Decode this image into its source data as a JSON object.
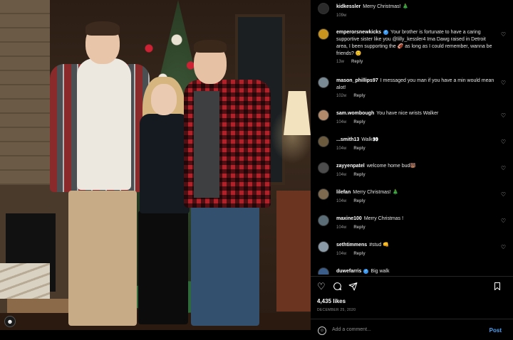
{
  "post": {
    "author": "kidkessler",
    "caption": "Merry Christmas! 🎄",
    "caption_time": "109w",
    "likes": "4,435 likes",
    "date": "DECEMBER 25, 2020",
    "add_comment_placeholder": "Add a comment...",
    "post_label": "Post"
  },
  "comments": [
    {
      "user": "emperorsnewkicks",
      "verified": true,
      "text": "Your brother is fortunate to have a caring supportive sister like you @lilly_kessler4 Ima Dawg raised in Detroit area, I been supporting the 🏈 as long as I could remember, wanna be friends? 😊",
      "time": "13w",
      "reply": "Reply"
    },
    {
      "user": "mason_phillips97",
      "verified": false,
      "text": "I messaged you man if you have a min would mean alot!",
      "time": "102w",
      "reply": "Reply"
    },
    {
      "user": "sam.wombough",
      "verified": false,
      "text": "You have nice wrists Walker",
      "time": "104w",
      "reply": "Reply"
    },
    {
      "user": "...smith13",
      "verified": false,
      "text": "Walk👀",
      "time": "104w",
      "reply": "Reply"
    },
    {
      "user": "zayyenpatel",
      "verified": false,
      "text": "welcome home bud🐻",
      "time": "104w",
      "reply": "Reply"
    },
    {
      "user": "lilefan",
      "verified": false,
      "text": "Merry Christmas! 🎄",
      "time": "104w",
      "reply": "Reply"
    },
    {
      "user": "maxine100",
      "verified": false,
      "text": "Merry Christmas !",
      "time": "104w",
      "reply": "Reply"
    },
    {
      "user": "sethtimmens",
      "verified": false,
      "text": "#stud 👊",
      "time": "104w",
      "reply": "Reply"
    },
    {
      "user": "duwefarris",
      "verified": true,
      "text": "Big walk",
      "time": "",
      "reply": ""
    }
  ],
  "icons": {
    "heart": "heart-icon",
    "comment": "comment-icon",
    "share": "share-icon",
    "save": "bookmark-icon",
    "emoji": "emoji-icon",
    "tag": "user-tag-icon"
  },
  "colors": {
    "background": "#000000",
    "link_blue": "#4aa3f5",
    "muted": "#8e8e8e"
  }
}
